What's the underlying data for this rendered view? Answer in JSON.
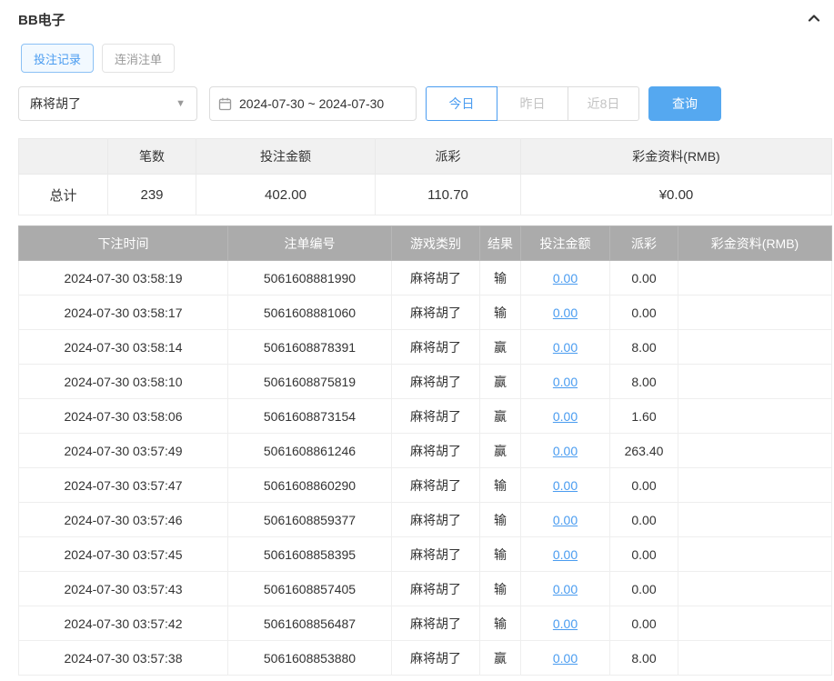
{
  "colors": {
    "accent_blue": "#4a9cf0",
    "search_button_blue": "#55a8f0",
    "table_header_gray": "#ababab"
  },
  "header": {
    "title": "BB电子"
  },
  "tabs": {
    "bet_records": "投注记录",
    "cancelled_orders": "连消注单"
  },
  "filters": {
    "game_select_value": "麻将胡了",
    "date_range_value": "2024-07-30 ~ 2024-07-30",
    "quick_today": "今日",
    "quick_yesterday": "昨日",
    "quick_last8": "近8日",
    "search_button": "查询"
  },
  "summary": {
    "headers": [
      "",
      "笔数",
      "投注金额",
      "派彩",
      "彩金资料(RMB)"
    ],
    "row_label": "总计",
    "count": "239",
    "bet_amount": "402.00",
    "payout": "110.70",
    "jackpot": "¥0.00"
  },
  "table": {
    "headers": [
      "下注时间",
      "注单编号",
      "游戏类别",
      "结果",
      "投注金额",
      "派彩",
      "彩金资料(RMB)"
    ],
    "rows": [
      {
        "time": "2024-07-30 03:58:19",
        "order_no": "5061608881990",
        "game": "麻将胡了",
        "result": "输",
        "bet": "0.00",
        "payout": "0.00",
        "jackpot": ""
      },
      {
        "time": "2024-07-30 03:58:17",
        "order_no": "5061608881060",
        "game": "麻将胡了",
        "result": "输",
        "bet": "0.00",
        "payout": "0.00",
        "jackpot": ""
      },
      {
        "time": "2024-07-30 03:58:14",
        "order_no": "5061608878391",
        "game": "麻将胡了",
        "result": "赢",
        "bet": "0.00",
        "payout": "8.00",
        "jackpot": ""
      },
      {
        "time": "2024-07-30 03:58:10",
        "order_no": "5061608875819",
        "game": "麻将胡了",
        "result": "赢",
        "bet": "0.00",
        "payout": "8.00",
        "jackpot": ""
      },
      {
        "time": "2024-07-30 03:58:06",
        "order_no": "5061608873154",
        "game": "麻将胡了",
        "result": "赢",
        "bet": "0.00",
        "payout": "1.60",
        "jackpot": ""
      },
      {
        "time": "2024-07-30 03:57:49",
        "order_no": "5061608861246",
        "game": "麻将胡了",
        "result": "赢",
        "bet": "0.00",
        "payout": "263.40",
        "jackpot": ""
      },
      {
        "time": "2024-07-30 03:57:47",
        "order_no": "5061608860290",
        "game": "麻将胡了",
        "result": "输",
        "bet": "0.00",
        "payout": "0.00",
        "jackpot": ""
      },
      {
        "time": "2024-07-30 03:57:46",
        "order_no": "5061608859377",
        "game": "麻将胡了",
        "result": "输",
        "bet": "0.00",
        "payout": "0.00",
        "jackpot": ""
      },
      {
        "time": "2024-07-30 03:57:45",
        "order_no": "5061608858395",
        "game": "麻将胡了",
        "result": "输",
        "bet": "0.00",
        "payout": "0.00",
        "jackpot": ""
      },
      {
        "time": "2024-07-30 03:57:43",
        "order_no": "5061608857405",
        "game": "麻将胡了",
        "result": "输",
        "bet": "0.00",
        "payout": "0.00",
        "jackpot": ""
      },
      {
        "time": "2024-07-30 03:57:42",
        "order_no": "5061608856487",
        "game": "麻将胡了",
        "result": "输",
        "bet": "0.00",
        "payout": "0.00",
        "jackpot": ""
      },
      {
        "time": "2024-07-30 03:57:38",
        "order_no": "5061608853880",
        "game": "麻将胡了",
        "result": "赢",
        "bet": "0.00",
        "payout": "8.00",
        "jackpot": ""
      }
    ]
  }
}
